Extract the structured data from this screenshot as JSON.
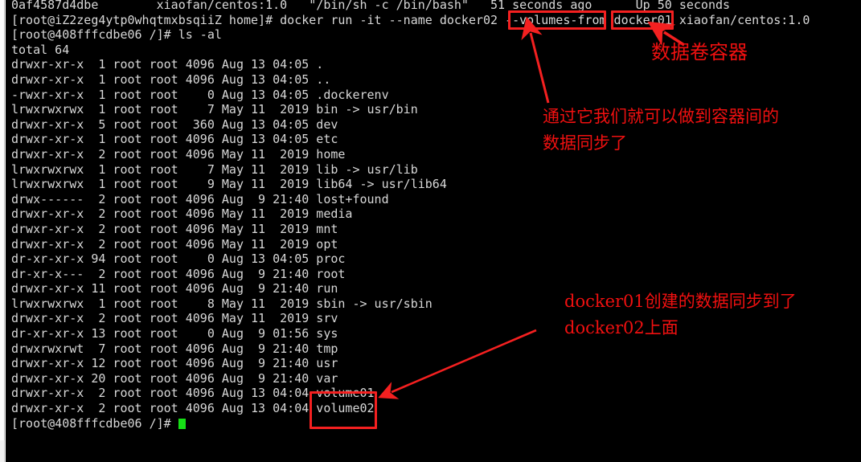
{
  "terminal": {
    "background": "#000000",
    "foreground": "#d8d8d8",
    "cursor_color": "#16e016",
    "lines": [
      "0af4587d4dbe        xiaofan/centos:1.0   \"/bin/sh -c /bin/bash\"   51 seconds ago      Up 50 seconds",
      "[root@iZ2zeg4ytp0whqtmxbsqiiZ home]# docker run -it --name docker02 --volumes-from docker01 xiaofan/centos:1.0",
      "[root@408fffcdbe06 /]# ls -al",
      "total 64",
      "drwxr-xr-x  1 root root 4096 Aug 13 04:05 .",
      "drwxr-xr-x  1 root root 4096 Aug 13 04:05 ..",
      "-rwxr-xr-x  1 root root    0 Aug 13 04:05 .dockerenv",
      "lrwxrwxrwx  1 root root    7 May 11  2019 bin -> usr/bin",
      "drwxr-xr-x  5 root root  360 Aug 13 04:05 dev",
      "drwxr-xr-x  1 root root 4096 Aug 13 04:05 etc",
      "drwxr-xr-x  2 root root 4096 May 11  2019 home",
      "lrwxrwxrwx  1 root root    7 May 11  2019 lib -> usr/lib",
      "lrwxrwxrwx  1 root root    9 May 11  2019 lib64 -> usr/lib64",
      "drwx------  2 root root 4096 Aug  9 21:40 lost+found",
      "drwxr-xr-x  2 root root 4096 May 11  2019 media",
      "drwxr-xr-x  2 root root 4096 May 11  2019 mnt",
      "drwxr-xr-x  2 root root 4096 May 11  2019 opt",
      "dr-xr-xr-x 94 root root    0 Aug 13 04:05 proc",
      "dr-xr-x---  2 root root 4096 Aug  9 21:40 root",
      "drwxr-xr-x 11 root root 4096 Aug  9 21:40 run",
      "lrwxrwxrwx  1 root root    8 May 11  2019 sbin -> usr/sbin",
      "drwxr-xr-x  2 root root 4096 May 11  2019 srv",
      "dr-xr-xr-x 13 root root    0 Aug  9 01:56 sys",
      "drwxrwxrwt  7 root root 4096 Aug  9 21:40 tmp",
      "drwxr-xr-x 12 root root 4096 Aug  9 21:40 usr",
      "drwxr-xr-x 20 root root 4096 Aug  9 21:40 var",
      "drwxr-xr-x  2 root root 4096 Aug 13 04:04 volume01",
      "drwxr-xr-x  2 root root 4096 Aug 13 04:04 volume02"
    ],
    "prompt_line": "[root@408fffcdbe06 /]# "
  },
  "annotations": {
    "color": "#f01010",
    "box_color": "#f42020",
    "boxes": [
      {
        "id": "volumes-from-flag",
        "label": "--volumes-from"
      },
      {
        "id": "docker01-name",
        "label": "docker01"
      },
      {
        "id": "volume-dirs",
        "label": "volume01 volume02"
      }
    ],
    "notes": {
      "data_volume_container": "数据卷容器",
      "sync_explanation_line1": "通过它我们就可以做到容器间的",
      "sync_explanation_line2": "数据同步了",
      "synced_line1": "docker01创建的数据同步到了",
      "synced_line2": "docker02上面"
    }
  }
}
